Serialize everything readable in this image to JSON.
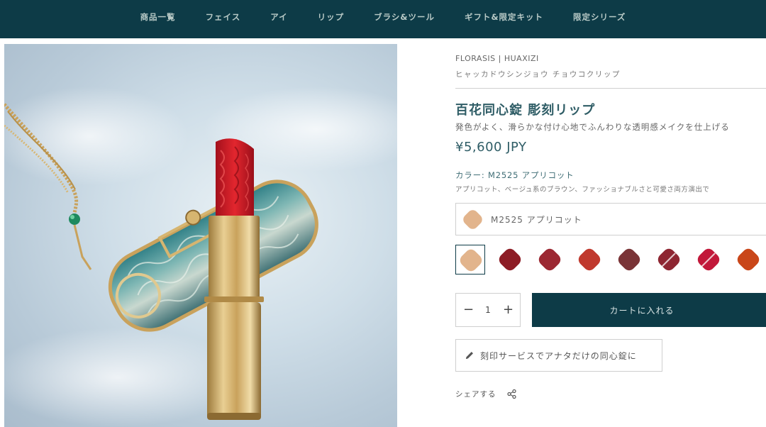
{
  "nav": {
    "items": [
      "商品一覧",
      "フェイス",
      "アイ",
      "リップ",
      "ブラシ&ツール",
      "ギフト&限定キット",
      "限定シリーズ"
    ]
  },
  "product": {
    "brand": "FLORASIS | HUAXIZI",
    "reading": "ヒャッカドウシンジョウ チョウコクリップ",
    "title": "百花同心錠 彫刻リップ",
    "description": "発色がよく、滑らかな付け心地でふんわりな透明感メイクを仕上げる",
    "price": "¥5,600 JPY",
    "color_label": "カラー: M2525 アプリコット",
    "color_description": "アプリコット、ベージュ系のブラウン、ファッショナブルさと可愛さ両方演出で",
    "selected_shade": "M2525 アプリコット",
    "selected_color": "#e2b48c",
    "quantity": "1",
    "qty_minus": "−",
    "qty_plus": "+",
    "cart_label": "カートに入れる",
    "engrave_label": "刻印サービスでアナタだけの同心錠に",
    "share_label": "シェアする"
  },
  "swatches": [
    {
      "color": "#e2b48c",
      "selected": true,
      "sold_out": false
    },
    {
      "color": "#8d1c25",
      "selected": false,
      "sold_out": false
    },
    {
      "color": "#9c2832",
      "selected": false,
      "sold_out": false
    },
    {
      "color": "#c0392e",
      "selected": false,
      "sold_out": false
    },
    {
      "color": "#7a3437",
      "selected": false,
      "sold_out": false
    },
    {
      "color": "#8e2632",
      "selected": false,
      "sold_out": true
    },
    {
      "color": "#c2183a",
      "selected": false,
      "sold_out": true
    },
    {
      "color": "#c94619",
      "selected": false,
      "sold_out": false
    }
  ],
  "theme": {
    "nav_bg": "#0d3b47",
    "accent": "#2f5d66"
  },
  "icons": {
    "engrave": "pencil-icon",
    "share": "share-icon"
  }
}
